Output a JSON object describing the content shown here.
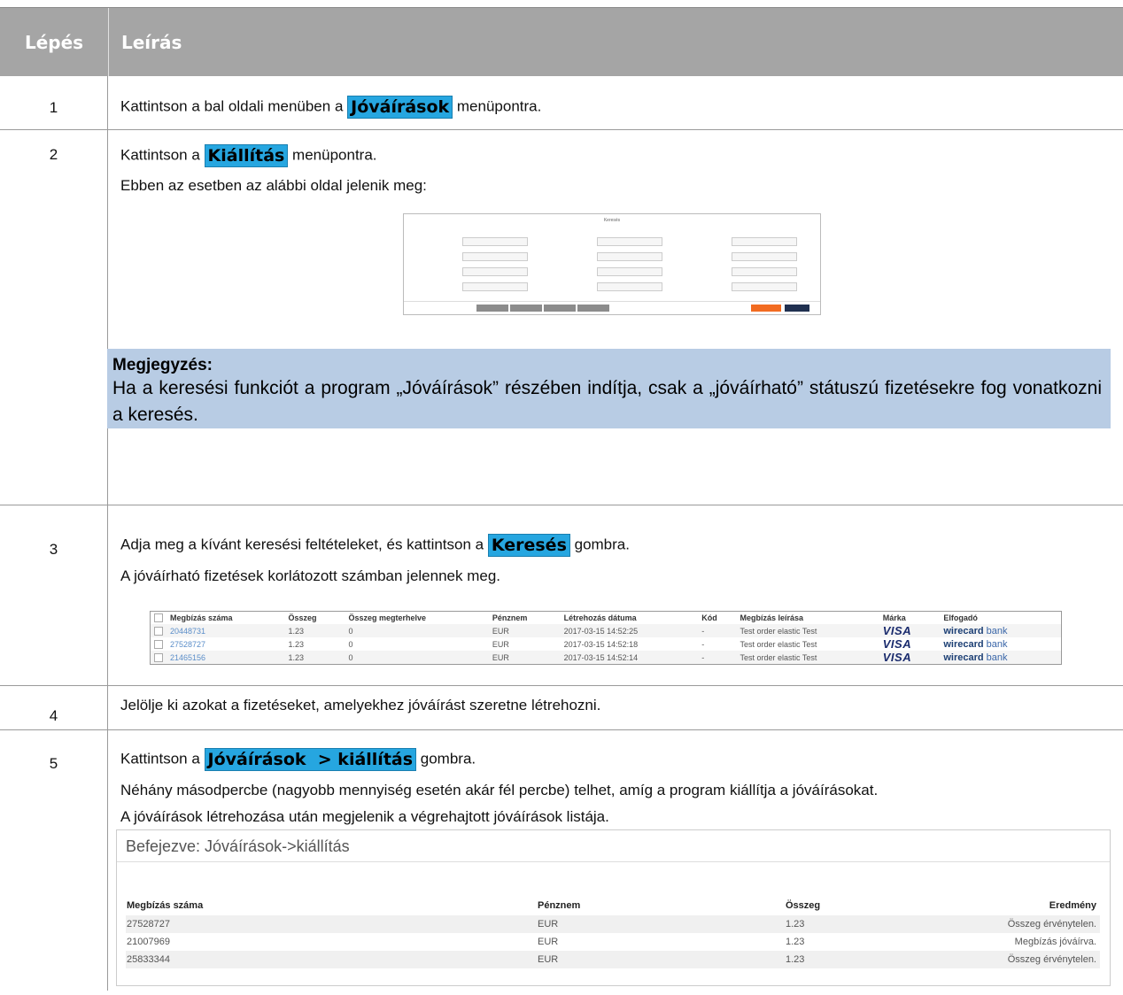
{
  "header": {
    "col_step": "Lépés",
    "col_desc": "Leírás"
  },
  "steps": {
    "s1": {
      "num": "1",
      "pre": "Kattintson a bal oldali menüben a ",
      "btn": "Jóváírások",
      "post": " menüpontra."
    },
    "s2": {
      "num": "2",
      "pre": "Kattintson a ",
      "btn": "Kiállítás",
      "post": " menüpontra.",
      "line2": "Ebben az esetben az alábbi oldal jelenik meg:",
      "search_title": "Keresés",
      "note_title": "Megjegyzés:",
      "note_body": "Ha a keresési funkciót a program „Jóváírások” részében indítja, csak a „jóváírható” státuszú fizetésekre fog vonatkozni a keresés."
    },
    "s3": {
      "num": "3",
      "pre": "Adja meg a kívánt keresési feltételeket, és kattintson a ",
      "btn": "Keresés",
      "post": " gombra.",
      "line2": "A jóváírható fizetések korlátozott számban jelennek meg.",
      "table": {
        "headers": [
          "Megbízás száma",
          "Összeg",
          "Összeg megterhelve",
          "Pénznem",
          "Létrehozás dátuma",
          "Kód",
          "Megbízás leírása",
          "Márka",
          "Elfogadó"
        ],
        "rows": [
          [
            "20448731",
            "1.23",
            "0",
            "EUR",
            "2017-03-15 14:52:25",
            "-",
            "Test order elastic Test",
            "VISA",
            "wirecard",
            "bank"
          ],
          [
            "27528727",
            "1.23",
            "0",
            "EUR",
            "2017-03-15 14:52:18",
            "-",
            "Test order elastic Test",
            "VISA",
            "wirecard",
            "bank"
          ],
          [
            "21465156",
            "1.23",
            "0",
            "EUR",
            "2017-03-15 14:52:14",
            "-",
            "Test order elastic Test",
            "VISA",
            "wirecard",
            "bank"
          ]
        ]
      }
    },
    "s4": {
      "num": "4",
      "text": "Jelölje ki azokat a fizetéseket, amelyekhez jóváírást szeretne létrehozni."
    },
    "s5": {
      "num": "5",
      "pre": "Kattintson a ",
      "btn": "Jóváírások  > kiállítás",
      "post": " gombra.",
      "line2": "Néhány másodpercbe (nagyobb mennyiség esetén akár fél percbe) telhet, amíg a program kiállítja a jóváírásokat.",
      "line3": "A jóváírások létrehozása után megjelenik a végrehajtott jóváírások listája.",
      "panel_title": "Befejezve: Jóváírások->kiállítás",
      "table": {
        "headers": [
          "Megbízás száma",
          "Pénznem",
          "Összeg",
          "Eredmény"
        ],
        "rows": [
          [
            "27528727",
            "EUR",
            "1.23",
            "Összeg érvénytelen."
          ],
          [
            "21007969",
            "EUR",
            "1.23",
            "Megbízás jóváírva."
          ],
          [
            "25833344",
            "EUR",
            "1.23",
            "Összeg érvénytelen."
          ]
        ]
      }
    }
  },
  "colors": {
    "header_bg": "#a5a5a5",
    "button_ref": "#26a6e0",
    "note_bg": "#b8cce4"
  }
}
